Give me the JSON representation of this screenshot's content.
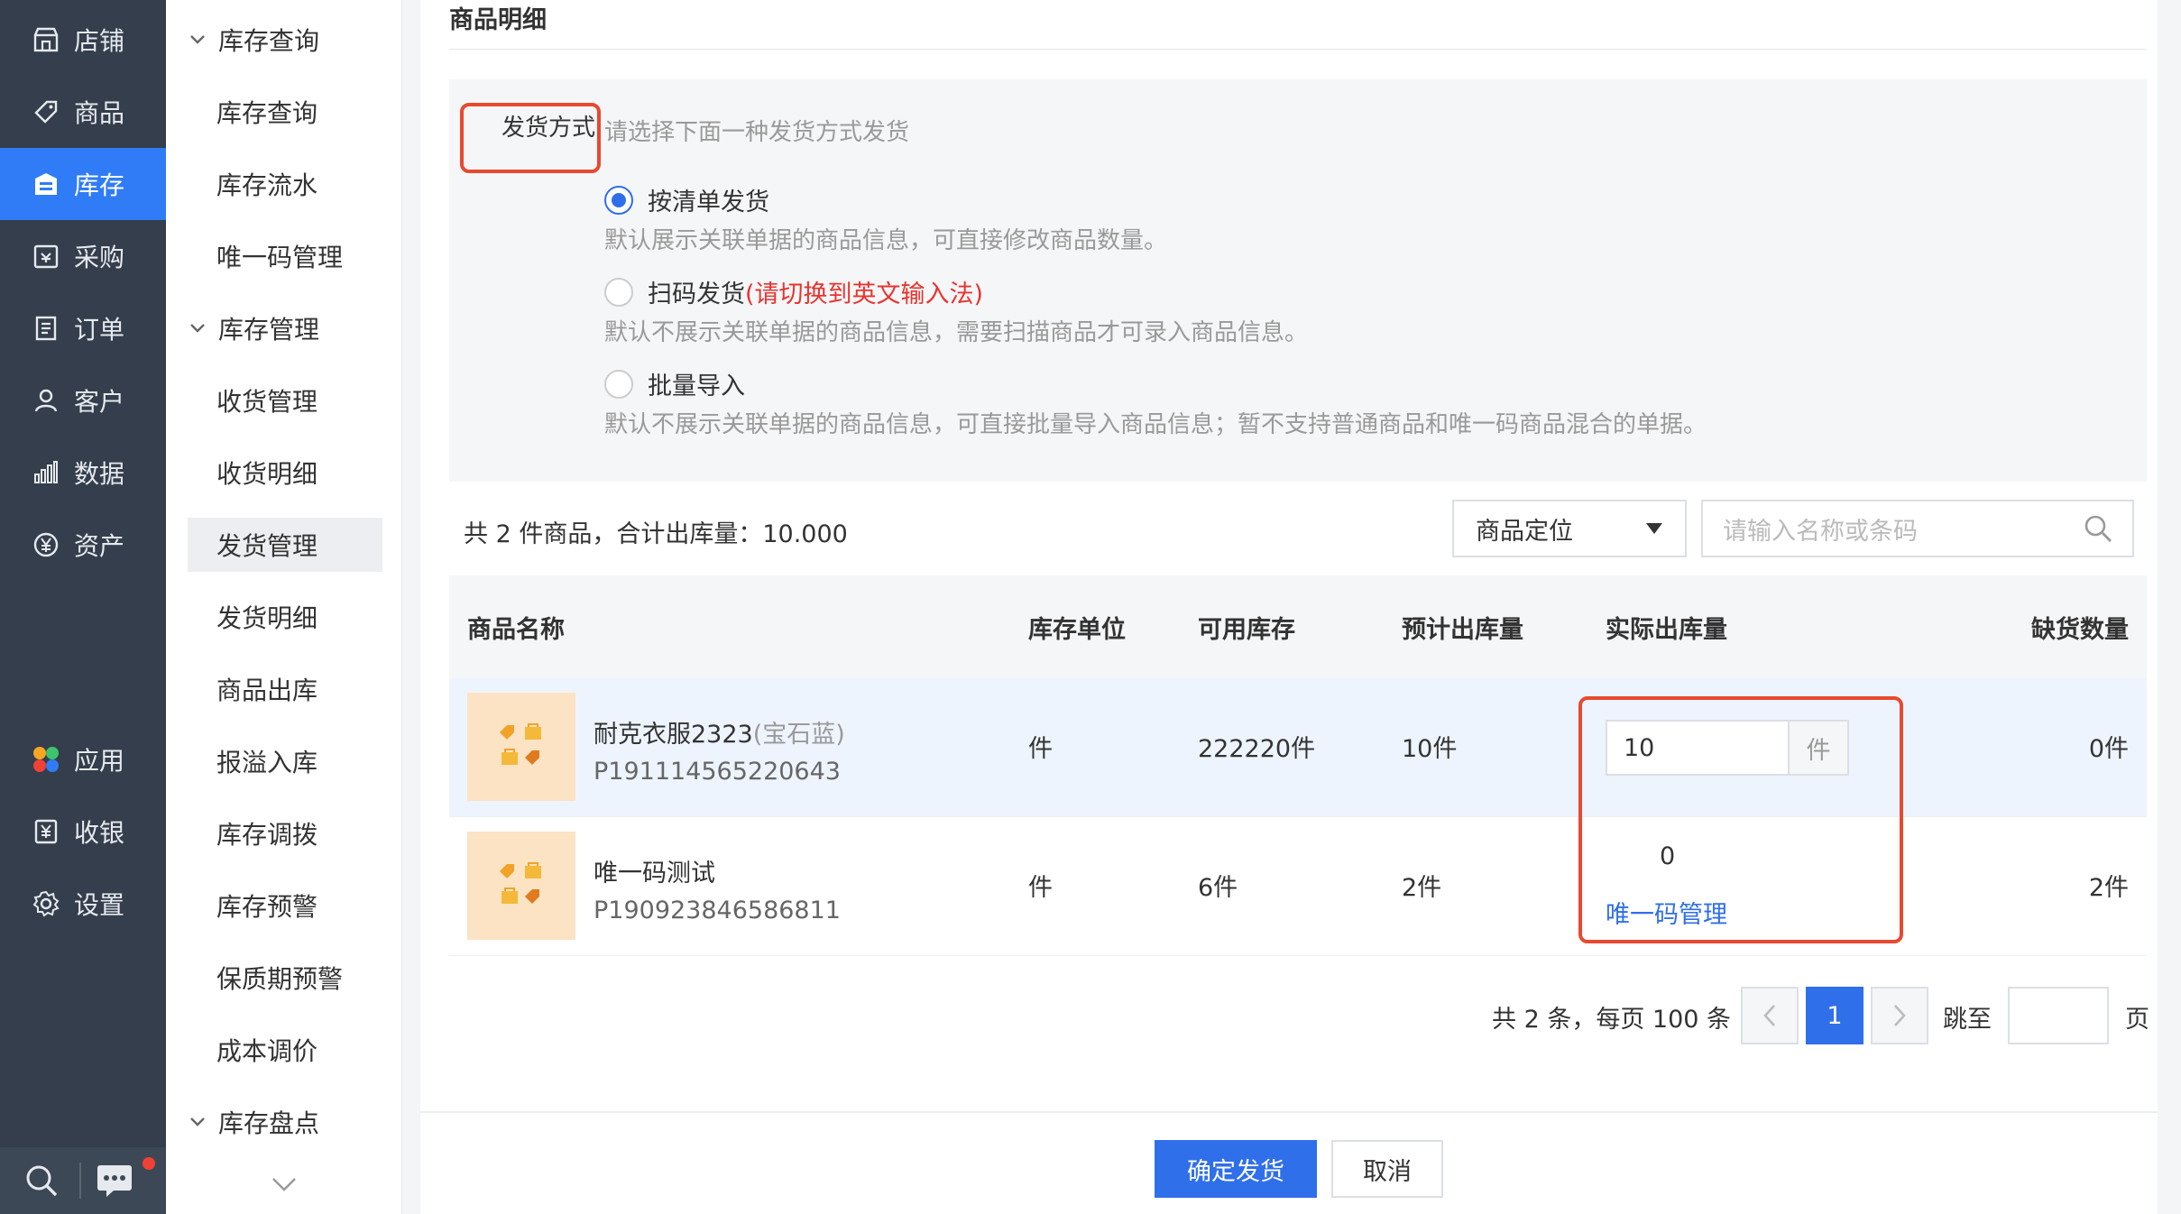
{
  "nav": {
    "items": [
      {
        "label": "店铺",
        "icon": "store-icon"
      },
      {
        "label": "商品",
        "icon": "tag-icon"
      },
      {
        "label": "库存",
        "icon": "inventory-icon"
      },
      {
        "label": "采购",
        "icon": "purchase-icon"
      },
      {
        "label": "订单",
        "icon": "order-icon"
      },
      {
        "label": "客户",
        "icon": "user-icon"
      },
      {
        "label": "数据",
        "icon": "chart-icon"
      },
      {
        "label": "资产",
        "icon": "yen-icon"
      },
      {
        "label": "应用",
        "icon": "apps-icon"
      },
      {
        "label": "收银",
        "icon": "cashier-icon"
      },
      {
        "label": "设置",
        "icon": "gear-icon"
      }
    ],
    "active": "库存"
  },
  "menu": {
    "group1": "库存查询",
    "group1_items": [
      "库存查询",
      "库存流水",
      "唯一码管理"
    ],
    "group2": "库存管理",
    "group2_items": [
      "收货管理",
      "收货明细",
      "发货管理",
      "发货明细",
      "商品出库",
      "报溢入库",
      "库存调拨",
      "库存预警",
      "保质期预警",
      "成本调价"
    ],
    "group3": "库存盘点",
    "active": "发货管理"
  },
  "main": {
    "section_title": "商品明细",
    "ship_method": {
      "label": "发货方式:",
      "hint": "请选择下面一种发货方式发货",
      "options": [
        {
          "label": "按清单发货",
          "warn": "",
          "desc": "默认展示关联单据的商品信息，可直接修改商品数量。",
          "selected": true
        },
        {
          "label": "扫码发货",
          "warn": "(请切换到英文输入法)",
          "desc": "默认不展示关联单据的商品信息，需要扫描商品才可录入商品信息。",
          "selected": false
        },
        {
          "label": "批量导入",
          "warn": "",
          "desc": "默认不展示关联单据的商品信息，可直接批量导入商品信息；暂不支持普通商品和唯一码商品混合的单据。",
          "selected": false
        }
      ]
    },
    "summary": "共 2 件商品，合计出库量：10.000",
    "locate_select": "商品定位",
    "search_placeholder": "请输入名称或条码",
    "table": {
      "headers": [
        "商品名称",
        "库存单位",
        "可用库存",
        "预计出库量",
        "实际出库量",
        "缺货数量"
      ],
      "rows": [
        {
          "name": "耐克衣服2323",
          "variant": "(宝石蓝)",
          "code": "P191114565220643",
          "unit": "件",
          "available": "222220件",
          "expected": "10件",
          "actual": "10",
          "actual_unit": "件",
          "shortage": "0件"
        },
        {
          "name": "唯一码测试",
          "variant": "",
          "code": "P190923846586811",
          "unit": "件",
          "available": "6件",
          "expected": "2件",
          "actual": "0",
          "actual_link": "唯一码管理",
          "shortage": "2件"
        }
      ]
    },
    "pagination": {
      "total_text": "共 2 条，每页 100 条",
      "current_page": "1",
      "jump_label": "跳至",
      "page_suffix": "页"
    },
    "buttons": {
      "confirm": "确定发货",
      "cancel": "取消"
    }
  },
  "colors": {
    "nav_bg": "#343e4c",
    "accent": "#2f6fea",
    "highlight": "#e8492f",
    "warn": "#e8342f"
  }
}
